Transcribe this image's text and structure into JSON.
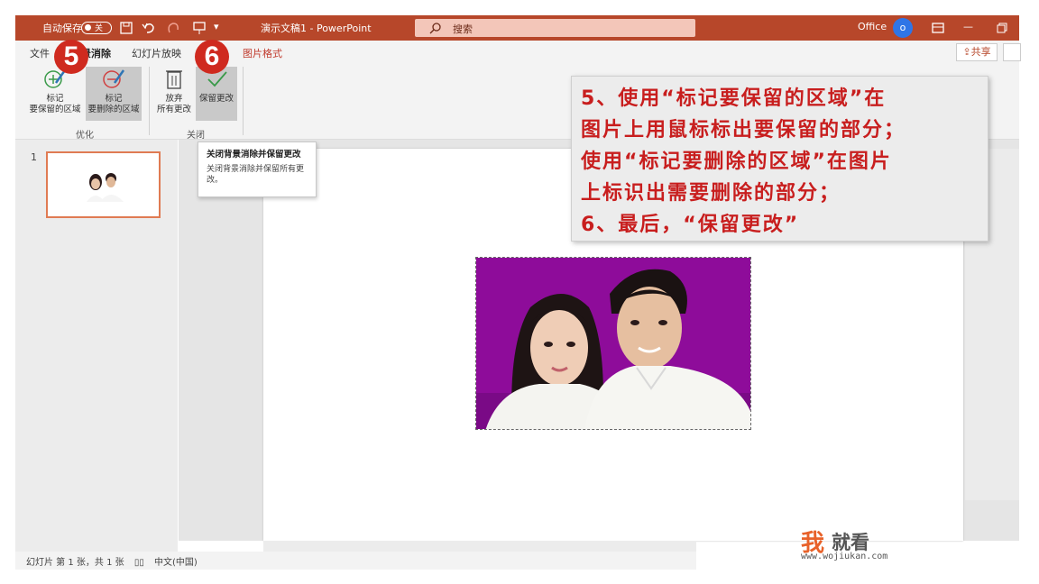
{
  "titlebar": {
    "autosave_label": "自动保存",
    "autosave_state": "关",
    "doc_title": "演示文稿1 - PowerPoint",
    "search_text": "搜索",
    "account": "Office",
    "avatar_text": "o"
  },
  "tabs": {
    "file": "文件",
    "bg_remove": "背景消除",
    "slideshow": "幻灯片放映",
    "picture_format": "图片格式"
  },
  "share": {
    "label": "共享"
  },
  "ribbon": {
    "mark_keep_1": "标记",
    "mark_keep_2": "要保留的区域",
    "mark_remove_1": "标记",
    "mark_remove_2": "要删除的区域",
    "discard_1": "放弃",
    "discard_2": "所有更改",
    "keep_changes": "保留更改",
    "group_refine": "优化",
    "group_close": "关闭"
  },
  "badges": {
    "step5": "5",
    "step6": "6"
  },
  "tooltip": {
    "title": "关闭背景消除并保留更改",
    "body": "关闭背景消除并保留所有更改。"
  },
  "thumbnails": {
    "slide_number": "1"
  },
  "annotation": {
    "line1": "5、使用“标记要保留的区域”在",
    "line2": "图片上用鼠标标出要保留的部分；",
    "line3": "使用“标记要删除的区域”在图片",
    "line4": "上标识出需要删除的部分；",
    "line5": "6、最后，“保留更改”"
  },
  "statusbar": {
    "slide_info": "幻灯片 第 1 张，共 1 张",
    "language": "中文(中国)"
  },
  "watermark": {
    "char1": "我",
    "rest": "就看",
    "url": "www.wojiukan.com"
  },
  "colors": {
    "titlebar": "#b7472a",
    "annotation_text": "#c81e1e",
    "photo_bg": "#8e0c9a",
    "badge": "#cf2a1f"
  }
}
